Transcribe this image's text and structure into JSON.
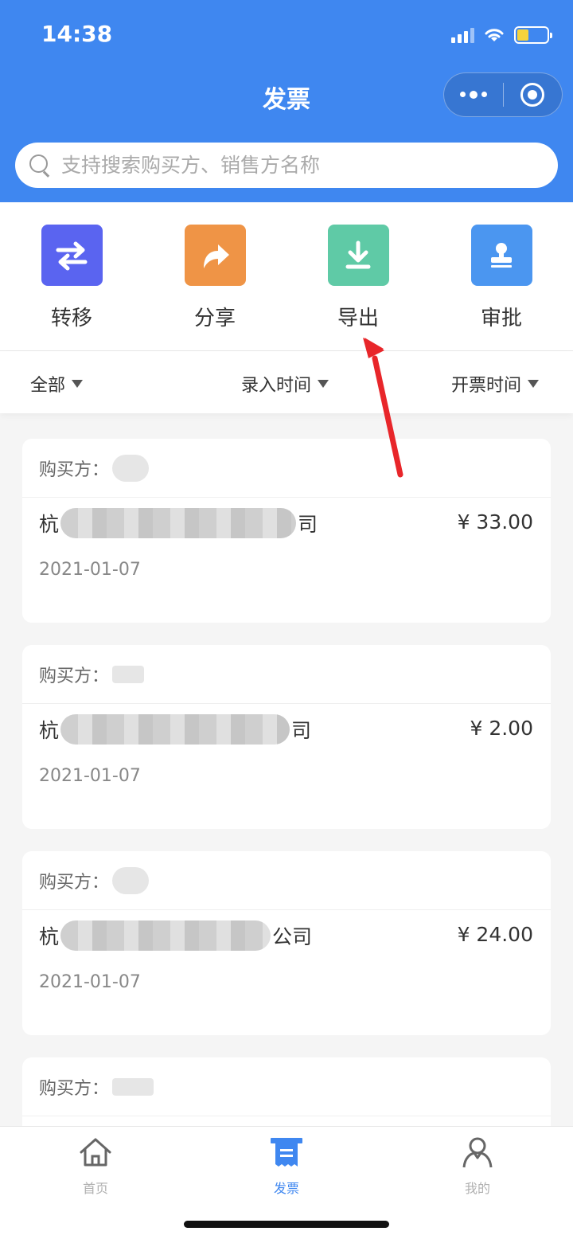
{
  "status_bar": {
    "time": "14:38"
  },
  "nav": {
    "title": "发票"
  },
  "search": {
    "placeholder": "支持搜索购买方、销售方名称"
  },
  "actions": [
    {
      "label": "转移",
      "icon": "swap-arrows-icon",
      "color": "#5a64f0"
    },
    {
      "label": "分享",
      "icon": "share-arrow-icon",
      "color": "#ef9446"
    },
    {
      "label": "导出",
      "icon": "download-icon",
      "color": "#5fcaa6"
    },
    {
      "label": "审批",
      "icon": "stamp-icon",
      "color": "#4b96f0"
    }
  ],
  "filters": {
    "all": "全部",
    "entry_time": "录入时间",
    "issue_time": "开票时间"
  },
  "invoices": [
    {
      "buyer_label": "购买方：",
      "seller_prefix": "杭",
      "seller_suffix": "司",
      "amount": "¥ 33.00",
      "date": "2021-01-07"
    },
    {
      "buyer_label": "购买方：",
      "seller_prefix": "杭",
      "seller_suffix": "司",
      "amount": "¥ 2.00",
      "date": "2021-01-07"
    },
    {
      "buyer_label": "购买方：",
      "seller_prefix": "杭",
      "seller_suffix": "公司",
      "amount": "¥ 24.00",
      "date": "2021-01-07"
    },
    {
      "buyer_label": "购买方："
    }
  ],
  "tabbar": [
    {
      "label": "首页",
      "icon": "home-icon",
      "active": false
    },
    {
      "label": "发票",
      "icon": "invoice-icon",
      "active": true
    },
    {
      "label": "我的",
      "icon": "user-icon",
      "active": false
    }
  ],
  "colors": {
    "primary": "#3f87f0",
    "annotation": "#e8262a"
  }
}
